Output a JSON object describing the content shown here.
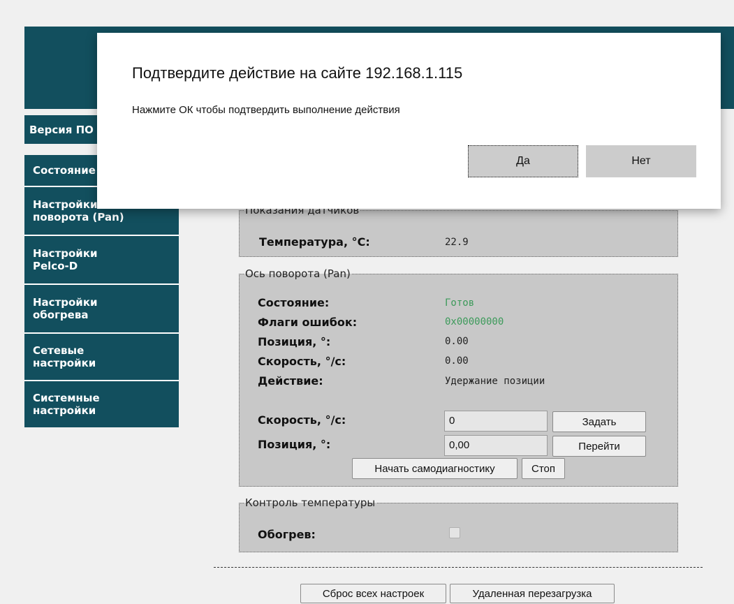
{
  "sidebar": {
    "version_label": "Версия ПО",
    "items": [
      {
        "label": "Состояние"
      },
      {
        "label": "Настройки\nповорота (Pan)"
      },
      {
        "label": "Настройки\nPelco-D"
      },
      {
        "label": "Настройки\nобогрева"
      },
      {
        "label": "Сетевые\nнастройки"
      },
      {
        "label": "Системные\nнастройки"
      }
    ]
  },
  "sensors": {
    "legend": "Показания датчиков",
    "temperature_label": "Температура, °C:",
    "temperature_value": "22.9"
  },
  "pan": {
    "legend": "Ось поворота (Pan)",
    "state_label": "Состояние:",
    "state_value": "Готов",
    "flags_label": "Флаги ошибок:",
    "flags_value": "0x00000000",
    "position_label": "Позиция, °:",
    "position_value": "0.00",
    "speed_label": "Скорость, °/с:",
    "speed_value": "0.00",
    "action_label": "Действие:",
    "action_value": "Удержание позиции",
    "speed_input_label": "Скорость, °/с:",
    "speed_input_value": "0",
    "set_button": "Задать",
    "position_input_label": "Позиция, °:",
    "position_input_value": "0,00",
    "goto_button": "Перейти",
    "selftest_button": "Начать самодиагностику",
    "stop_button": "Стоп"
  },
  "temperature_control": {
    "legend": "Контроль температуры",
    "heating_label": "Обогрев:",
    "heating_checked": false
  },
  "footer": {
    "reset_button": "Сброс всех настроек",
    "reboot_button": "Удаленная перезагрузка"
  },
  "dialog": {
    "title": "Подтвердите действие на сайте 192.168.1.115",
    "message": "Нажмите ОК чтобы подтвердить выполнение действия",
    "yes_button": "Да",
    "no_button": "Нет"
  },
  "colors": {
    "sidebar_bg": "#124f5e",
    "panel_bg": "#c8c8c8",
    "status_green": "#3c9a5a"
  }
}
